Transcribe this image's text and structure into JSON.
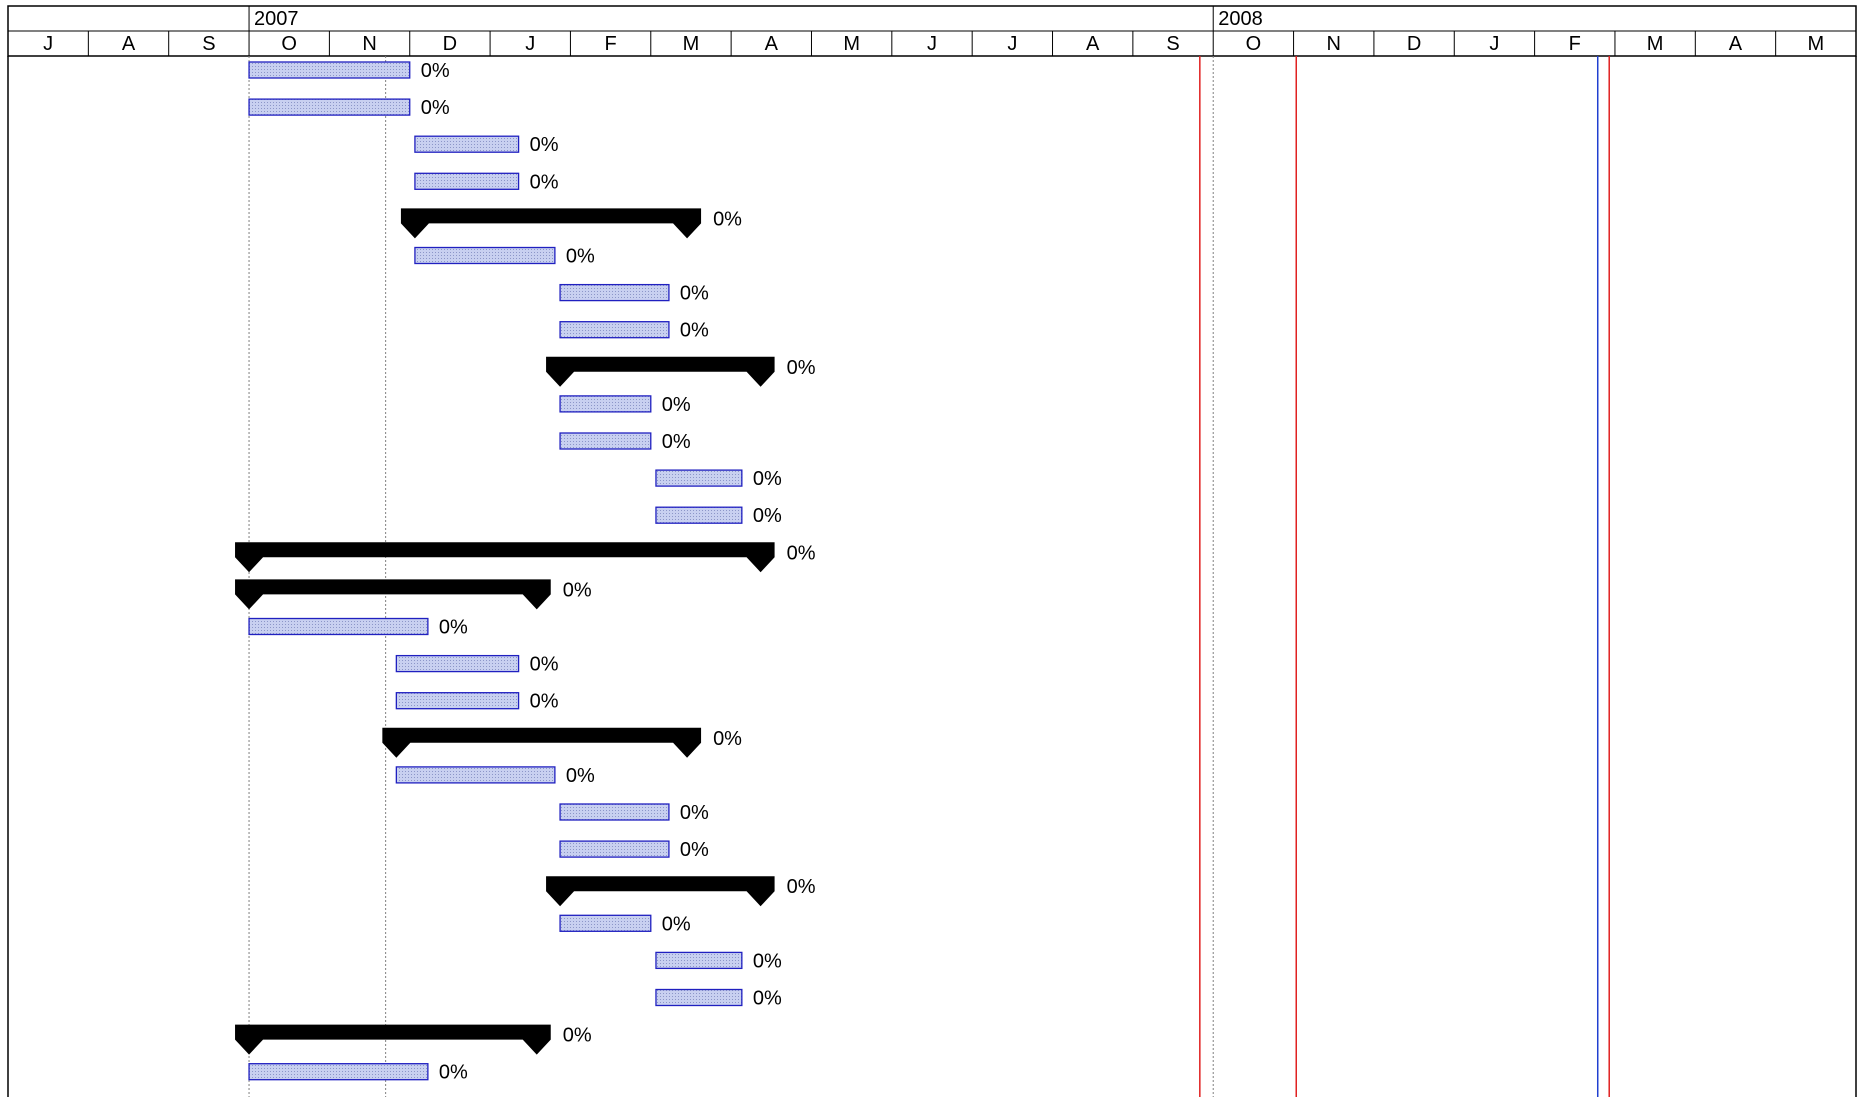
{
  "chart_data": {
    "type": "gantt",
    "years": [
      {
        "label": "2007",
        "start_month_index": 3
      },
      {
        "label": "2008",
        "start_month_index": 15
      }
    ],
    "months": [
      "J",
      "A",
      "S",
      "O",
      "N",
      "D",
      "J",
      "F",
      "M",
      "A",
      "M",
      "J",
      "J",
      "A",
      "S",
      "O",
      "N",
      "D",
      "J",
      "F",
      "M",
      "A",
      "M"
    ],
    "axis_start": "2007-07-01",
    "vertical_lines": [
      {
        "date": "2007-10-01",
        "style": "dotted",
        "color": "#808080"
      },
      {
        "date": "2007-11-22",
        "style": "dotted",
        "color": "#808080"
      },
      {
        "date": "2008-09-26",
        "style": "solid",
        "color": "#e02020"
      },
      {
        "date": "2008-10-01",
        "style": "dotted",
        "color": "#808080"
      },
      {
        "date": "2008-11-02",
        "style": "solid",
        "color": "#e02020"
      },
      {
        "date": "2009-02-23",
        "style": "solid",
        "color": "#2040d0"
      },
      {
        "date": "2009-02-27",
        "style": "solid",
        "color": "#e02020"
      }
    ],
    "rows": [
      {
        "kind": "task",
        "start": "2007-10-01",
        "end": "2007-12-01",
        "percent": "0%"
      },
      {
        "kind": "task",
        "start": "2007-10-01",
        "end": "2007-12-01",
        "percent": "0%"
      },
      {
        "kind": "task",
        "start": "2007-12-03",
        "end": "2008-01-12",
        "percent": "0%"
      },
      {
        "kind": "task",
        "start": "2007-12-03",
        "end": "2008-01-12",
        "percent": "0%"
      },
      {
        "kind": "summary",
        "start": "2007-12-03",
        "end": "2008-03-15",
        "percent": "0%"
      },
      {
        "kind": "task",
        "start": "2007-12-03",
        "end": "2008-01-26",
        "percent": "0%"
      },
      {
        "kind": "task",
        "start": "2008-01-28",
        "end": "2008-03-08",
        "percent": "0%"
      },
      {
        "kind": "task",
        "start": "2008-01-28",
        "end": "2008-03-08",
        "percent": "0%"
      },
      {
        "kind": "summary",
        "start": "2008-01-28",
        "end": "2008-04-12",
        "percent": "0%"
      },
      {
        "kind": "task",
        "start": "2008-01-28",
        "end": "2008-03-01",
        "percent": "0%"
      },
      {
        "kind": "task",
        "start": "2008-01-28",
        "end": "2008-03-01",
        "percent": "0%"
      },
      {
        "kind": "task",
        "start": "2008-03-03",
        "end": "2008-04-05",
        "percent": "0%"
      },
      {
        "kind": "task",
        "start": "2008-03-03",
        "end": "2008-04-05",
        "percent": "0%"
      },
      {
        "kind": "summary",
        "start": "2007-10-01",
        "end": "2008-04-12",
        "percent": "0%"
      },
      {
        "kind": "summary",
        "start": "2007-10-01",
        "end": "2008-01-19",
        "percent": "0%"
      },
      {
        "kind": "task",
        "start": "2007-10-01",
        "end": "2007-12-08",
        "percent": "0%"
      },
      {
        "kind": "task",
        "start": "2007-11-26",
        "end": "2008-01-12",
        "percent": "0%"
      },
      {
        "kind": "task",
        "start": "2007-11-26",
        "end": "2008-01-12",
        "percent": "0%"
      },
      {
        "kind": "summary",
        "start": "2007-11-26",
        "end": "2008-03-15",
        "percent": "0%"
      },
      {
        "kind": "task",
        "start": "2007-11-26",
        "end": "2008-01-26",
        "percent": "0%"
      },
      {
        "kind": "task",
        "start": "2008-01-28",
        "end": "2008-03-08",
        "percent": "0%"
      },
      {
        "kind": "task",
        "start": "2008-01-28",
        "end": "2008-03-08",
        "percent": "0%"
      },
      {
        "kind": "summary",
        "start": "2008-01-28",
        "end": "2008-04-12",
        "percent": "0%"
      },
      {
        "kind": "task",
        "start": "2008-01-28",
        "end": "2008-03-01",
        "percent": "0%"
      },
      {
        "kind": "task",
        "start": "2008-03-03",
        "end": "2008-04-05",
        "percent": "0%"
      },
      {
        "kind": "task",
        "start": "2008-03-03",
        "end": "2008-04-05",
        "percent": "0%"
      },
      {
        "kind": "summary",
        "start": "2007-10-01",
        "end": "2008-01-19",
        "percent": "0%"
      },
      {
        "kind": "task",
        "start": "2007-10-01",
        "end": "2007-12-08",
        "percent": "0%"
      }
    ],
    "colors": {
      "task_fill": "#c8d0f0",
      "task_border": "#2020c0",
      "summary_fill": "#000000",
      "grid": "#000000"
    }
  }
}
